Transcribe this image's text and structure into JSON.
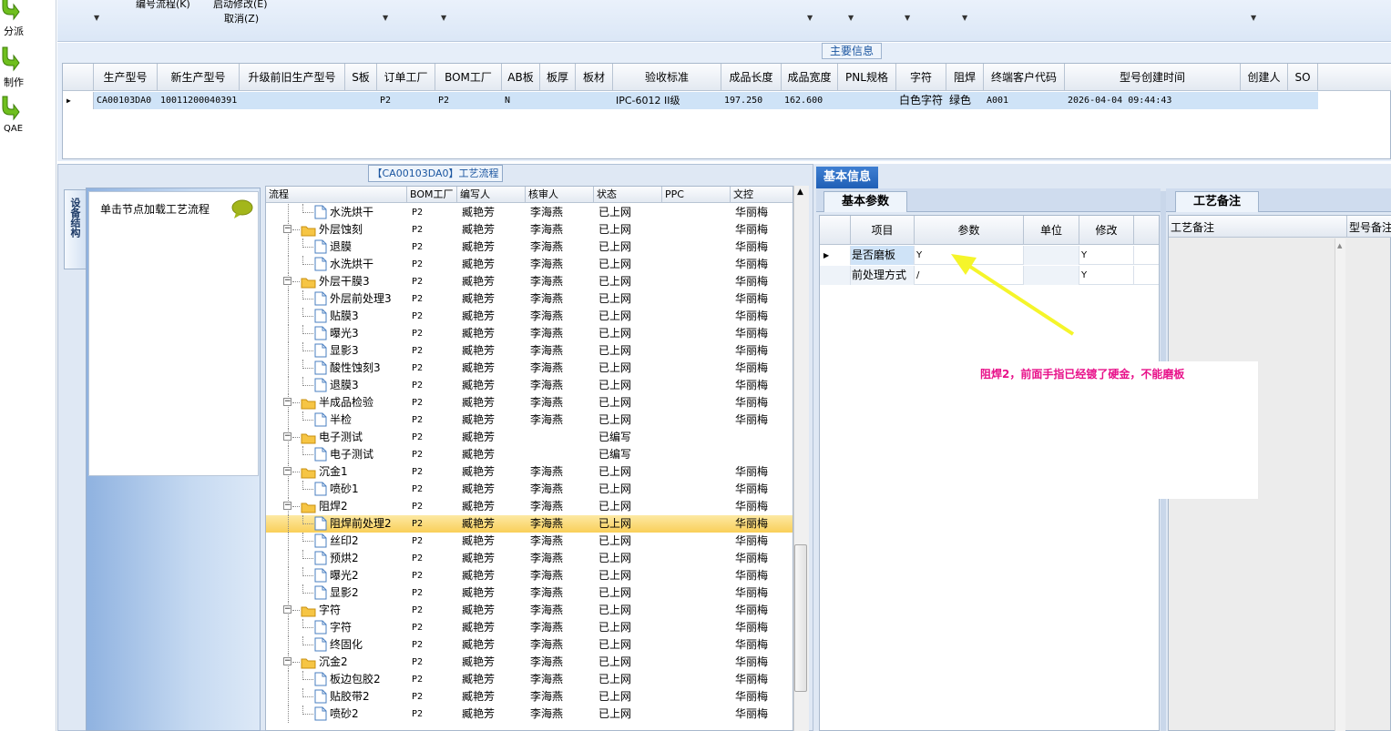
{
  "left_nav": [
    {
      "label": "分派",
      "icon": "green-arrow-icon"
    },
    {
      "label": "制作",
      "icon": "green-arrow-icon"
    },
    {
      "label": "QAE",
      "icon": "green-arrow-icon"
    }
  ],
  "toolbar": {
    "menu_edit_flow": "编号流程(K)",
    "menu_start_modify": "启动修改(E)",
    "menu_cancel": "取消(Z)"
  },
  "main_info": {
    "title": "主要信息",
    "columns": [
      "生产型号",
      "新生产型号",
      "升级前旧生产型号",
      "S板",
      "订单工厂",
      "BOM工厂",
      "AB板",
      "板厚",
      "板材",
      "验收标准",
      "成品长度",
      "成品宽度",
      "PNL规格",
      "字符",
      "阻焊",
      "终端客户代码",
      "型号创建时间",
      "创建人",
      "SO"
    ],
    "row": [
      "CA00103DA0",
      "10011200040391",
      "",
      "",
      "P2",
      "P2",
      "N",
      "",
      "",
      "IPC-6012 II级",
      "197.250",
      "162.600",
      "",
      "白色字符",
      "绿色",
      "A001",
      "2026-04-04 09:44:43",
      "",
      ""
    ]
  },
  "process": {
    "title": "【CA00103DA0】工艺流程",
    "side_tab": "设备结构",
    "hint": "单击节点加载工艺流程",
    "columns": [
      "流程",
      "BOM工厂",
      "编写人",
      "核审人",
      "状态",
      "PPC",
      "文控"
    ],
    "rows": [
      {
        "name": "水洗烘干",
        "level": 2,
        "bom": "P2",
        "writer": "臧艳芳",
        "reviewer": "李海燕",
        "status": "已上网",
        "ppc": "",
        "doc": "华丽梅"
      },
      {
        "name": "外层蚀刻",
        "level": 1,
        "bom": "P2",
        "writer": "臧艳芳",
        "reviewer": "李海燕",
        "status": "已上网",
        "ppc": "",
        "doc": "华丽梅"
      },
      {
        "name": "退膜",
        "level": 2,
        "bom": "P2",
        "writer": "臧艳芳",
        "reviewer": "李海燕",
        "status": "已上网",
        "ppc": "",
        "doc": "华丽梅"
      },
      {
        "name": "水洗烘干",
        "level": 2,
        "bom": "P2",
        "writer": "臧艳芳",
        "reviewer": "李海燕",
        "status": "已上网",
        "ppc": "",
        "doc": "华丽梅"
      },
      {
        "name": "外层干膜3",
        "level": 1,
        "bom": "P2",
        "writer": "臧艳芳",
        "reviewer": "李海燕",
        "status": "已上网",
        "ppc": "",
        "doc": "华丽梅"
      },
      {
        "name": "外层前处理3",
        "level": 2,
        "bom": "P2",
        "writer": "臧艳芳",
        "reviewer": "李海燕",
        "status": "已上网",
        "ppc": "",
        "doc": "华丽梅"
      },
      {
        "name": "贴膜3",
        "level": 2,
        "bom": "P2",
        "writer": "臧艳芳",
        "reviewer": "李海燕",
        "status": "已上网",
        "ppc": "",
        "doc": "华丽梅"
      },
      {
        "name": "曝光3",
        "level": 2,
        "bom": "P2",
        "writer": "臧艳芳",
        "reviewer": "李海燕",
        "status": "已上网",
        "ppc": "",
        "doc": "华丽梅"
      },
      {
        "name": "显影3",
        "level": 2,
        "bom": "P2",
        "writer": "臧艳芳",
        "reviewer": "李海燕",
        "status": "已上网",
        "ppc": "",
        "doc": "华丽梅"
      },
      {
        "name": "酸性蚀刻3",
        "level": 2,
        "bom": "P2",
        "writer": "臧艳芳",
        "reviewer": "李海燕",
        "status": "已上网",
        "ppc": "",
        "doc": "华丽梅"
      },
      {
        "name": "退膜3",
        "level": 2,
        "bom": "P2",
        "writer": "臧艳芳",
        "reviewer": "李海燕",
        "status": "已上网",
        "ppc": "",
        "doc": "华丽梅"
      },
      {
        "name": "半成品检验",
        "level": 1,
        "bom": "P2",
        "writer": "臧艳芳",
        "reviewer": "李海燕",
        "status": "已上网",
        "ppc": "",
        "doc": "华丽梅"
      },
      {
        "name": "半检",
        "level": 2,
        "bom": "P2",
        "writer": "臧艳芳",
        "reviewer": "李海燕",
        "status": "已上网",
        "ppc": "",
        "doc": "华丽梅"
      },
      {
        "name": "电子测试",
        "level": 1,
        "bom": "P2",
        "writer": "臧艳芳",
        "reviewer": "",
        "status": "已编写",
        "ppc": "",
        "doc": ""
      },
      {
        "name": "电子测试",
        "level": 2,
        "bom": "P2",
        "writer": "臧艳芳",
        "reviewer": "",
        "status": "已编写",
        "ppc": "",
        "doc": ""
      },
      {
        "name": "沉金1",
        "level": 1,
        "bom": "P2",
        "writer": "臧艳芳",
        "reviewer": "李海燕",
        "status": "已上网",
        "ppc": "",
        "doc": "华丽梅"
      },
      {
        "name": "喷砂1",
        "level": 2,
        "bom": "P2",
        "writer": "臧艳芳",
        "reviewer": "李海燕",
        "status": "已上网",
        "ppc": "",
        "doc": "华丽梅"
      },
      {
        "name": "阻焊2",
        "level": 1,
        "bom": "P2",
        "writer": "臧艳芳",
        "reviewer": "李海燕",
        "status": "已上网",
        "ppc": "",
        "doc": "华丽梅"
      },
      {
        "name": "阻焊前处理2",
        "level": 2,
        "bom": "P2",
        "writer": "臧艳芳",
        "reviewer": "李海燕",
        "status": "已上网",
        "ppc": "",
        "doc": "华丽梅",
        "selected": true
      },
      {
        "name": "丝印2",
        "level": 2,
        "bom": "P2",
        "writer": "臧艳芳",
        "reviewer": "李海燕",
        "status": "已上网",
        "ppc": "",
        "doc": "华丽梅"
      },
      {
        "name": "预烘2",
        "level": 2,
        "bom": "P2",
        "writer": "臧艳芳",
        "reviewer": "李海燕",
        "status": "已上网",
        "ppc": "",
        "doc": "华丽梅"
      },
      {
        "name": "曝光2",
        "level": 2,
        "bom": "P2",
        "writer": "臧艳芳",
        "reviewer": "李海燕",
        "status": "已上网",
        "ppc": "",
        "doc": "华丽梅"
      },
      {
        "name": "显影2",
        "level": 2,
        "bom": "P2",
        "writer": "臧艳芳",
        "reviewer": "李海燕",
        "status": "已上网",
        "ppc": "",
        "doc": "华丽梅"
      },
      {
        "name": "字符",
        "level": 1,
        "bom": "P2",
        "writer": "臧艳芳",
        "reviewer": "李海燕",
        "status": "已上网",
        "ppc": "",
        "doc": "华丽梅"
      },
      {
        "name": "字符",
        "level": 2,
        "bom": "P2",
        "writer": "臧艳芳",
        "reviewer": "李海燕",
        "status": "已上网",
        "ppc": "",
        "doc": "华丽梅"
      },
      {
        "name": "终固化",
        "level": 2,
        "bom": "P2",
        "writer": "臧艳芳",
        "reviewer": "李海燕",
        "status": "已上网",
        "ppc": "",
        "doc": "华丽梅"
      },
      {
        "name": "沉金2",
        "level": 1,
        "bom": "P2",
        "writer": "臧艳芳",
        "reviewer": "李海燕",
        "status": "已上网",
        "ppc": "",
        "doc": "华丽梅"
      },
      {
        "name": "板边包胶2",
        "level": 2,
        "bom": "P2",
        "writer": "臧艳芳",
        "reviewer": "李海燕",
        "status": "已上网",
        "ppc": "",
        "doc": "华丽梅"
      },
      {
        "name": "贴胶带2",
        "level": 2,
        "bom": "P2",
        "writer": "臧艳芳",
        "reviewer": "李海燕",
        "status": "已上网",
        "ppc": "",
        "doc": "华丽梅"
      },
      {
        "name": "喷砂2",
        "level": 2,
        "bom": "P2",
        "writer": "臧艳芳",
        "reviewer": "李海燕",
        "status": "已上网",
        "ppc": "",
        "doc": "华丽梅"
      }
    ]
  },
  "basic_info": {
    "title": "基本信息",
    "tab": "基本参数",
    "columns": [
      "项目",
      "参数",
      "单位",
      "修改"
    ],
    "rows": [
      {
        "item": "是否磨板",
        "param": "Y",
        "unit": "",
        "modify": "Y"
      },
      {
        "item": "前处理方式",
        "param": "/",
        "unit": "",
        "modify": "Y"
      }
    ]
  },
  "process_remark": {
    "tab": "工艺备注",
    "columns": [
      "工艺备注",
      "型号备注"
    ]
  },
  "annotation": {
    "text": "阻焊2，前面手指已经镀了硬金，不能磨板",
    "text_color": "#e8118a",
    "arrow_color": "#f5f52a"
  }
}
